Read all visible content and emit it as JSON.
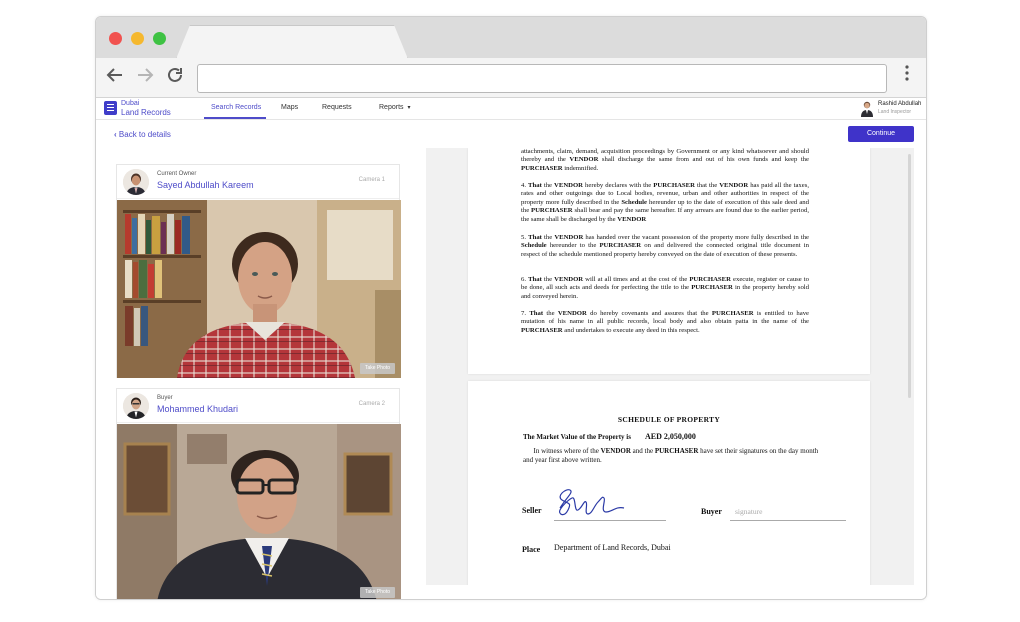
{
  "browser": {
    "url": "",
    "menu_icon": "kebab-menu-icon"
  },
  "app": {
    "logo_line1": "Dubai",
    "logo_line2": "Land Records",
    "nav": [
      {
        "label": "Search Records",
        "active": true
      },
      {
        "label": "Maps",
        "active": false
      },
      {
        "label": "Requests",
        "active": false
      },
      {
        "label": "Reports",
        "active": false
      }
    ],
    "reports_caret": "▾",
    "user": {
      "name": "Rashid Abdullah",
      "role": "Land Inspector"
    },
    "accent": "#3f33c9"
  },
  "actions": {
    "back": "Back to details",
    "continue": "Continue"
  },
  "cards": [
    {
      "role": "Current Owner",
      "name": "Sayed Abdullah Kareem",
      "camera": "Camera 1",
      "take_photo": "Take Photo"
    },
    {
      "role": "Buyer",
      "name": "Mohammed Khudari",
      "camera": "Camera 2",
      "take_photo": "Take Photo"
    }
  ],
  "document": {
    "para_intro": "attachments, claim, demand, acquisition proceedings by Government or any kind whatsoever and should thereby and the VENDOR shall discharge the same from and out of his own funds and keep the PURCHASER indemnified.",
    "para4": "4. That the VENDOR hereby declares with the PURCHASER that the VENDOR has paid all the taxes, rates and other outgoings due to Local bodies, revenue, urban and other authorities in respect of the property more fully described in the Schedule hereunder up to the date of execution of this sale deed and the PURCHASER shall bear and pay the same hereafter. If any arrears are found due to the earlier period, the same shall be discharged by the VENDOR",
    "para5": "5. That the VENDOR has handed over the vacant possession of the property more fully described in the Schedule hereunder to the PURCHASER on and delivered the connected original title document in respect of the schedule mentioned property hereby conveyed on the date of execution of these presents.",
    "para6": "6. That the VENDOR will at all times and at the cost of the PURCHASER execute, register or cause to be done, all such acts and deeds for perfecting the title to the PURCHASER in the property hereby sold and conveyed herein.",
    "para7": "7. That the VENDOR do hereby covenants and assures that the PURCHASER is entitled to have mutation of his name in all public records, local body and also obtain patta in the name of the PURCHASER and undertakes to execute any deed in this respect.",
    "schedule_title": "SCHEDULE OF PROPERTY",
    "market_value_label": "The Market Value of the Property is",
    "market_value": "AED 2,050,000",
    "witness_text": "In witness where of the VENDOR and the PURCHASER have set their signatures on the day month and year first above written.",
    "seller_label": "Seller",
    "buyer_label": "Buyer",
    "buyer_signature_placeholder": "signature",
    "place_label": "Place",
    "place_value": "Department of Land Records, Dubai"
  }
}
